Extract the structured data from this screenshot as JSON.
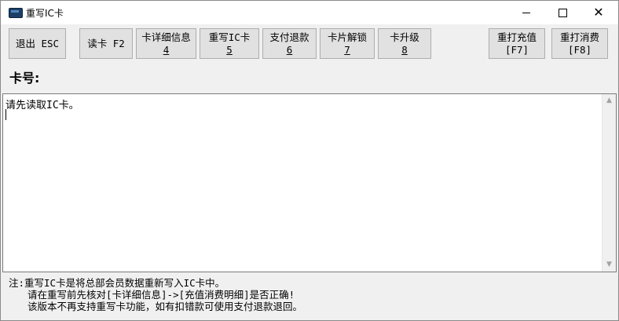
{
  "window": {
    "title": "重写IC卡"
  },
  "toolbar": {
    "exit": "退出 ESC",
    "read": "读卡 F2",
    "detail_l1": "卡详细信息",
    "detail_l2": "4",
    "rewrite_l1": "重写IC卡",
    "rewrite_l2": "5",
    "refund_l1": "支付退款",
    "refund_l2": "6",
    "unlock_l1": "卡片解锁",
    "unlock_l2": "7",
    "upgrade_l1": "卡升级",
    "upgrade_l2": "8",
    "reprint_recharge_l1": "重打充值",
    "reprint_recharge_l2": "[F7]",
    "reprint_consume_l1": "重打消费",
    "reprint_consume_l2": "[F8]"
  },
  "card": {
    "label": "卡号:"
  },
  "main": {
    "text": "请先读取IC卡。"
  },
  "notes": {
    "line1": "注:重写IC卡是将总部会员数据重新写入IC卡中。",
    "line2": "请在重写前先核对[卡详细信息]->[充值消费明细]是否正确!",
    "line3": "该版本不再支持重写卡功能，如有扣错款可使用支付退款退回。"
  },
  "icons": {
    "app": "card-icon",
    "minimize": "minimize-icon",
    "maximize": "maximize-icon",
    "close": "close-icon"
  }
}
